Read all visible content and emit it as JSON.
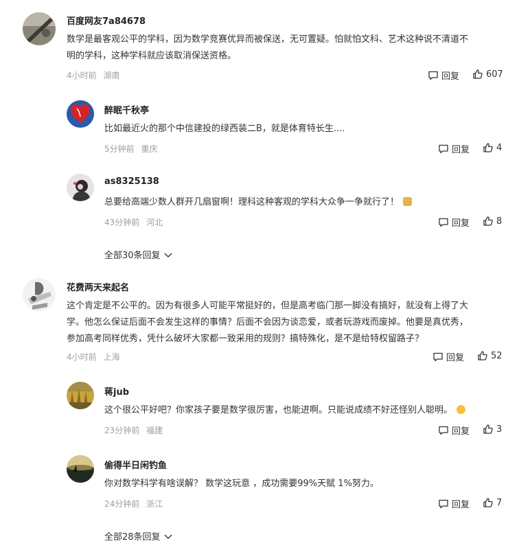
{
  "comments": [
    {
      "name": "百度网友7a84678",
      "lines": [
        "数学是最客观公平的学科，因为数学竞赛优异而被保送，无可置疑。怕就怕文科、艺术这种说不清道不",
        "明的学科，这种学科就应该取消保送资格。"
      ],
      "time": "4小时前",
      "region": "湖南",
      "reply": "回复",
      "likes": "607",
      "replies": [
        {
          "name": "醉眠千秋亭",
          "text": "比如最近火的那个中信建投的绿西装二B，就是体育特长生....",
          "time": "5分钟前",
          "region": "重庆",
          "reply": "回复",
          "likes": "4"
        },
        {
          "name": "as8325138",
          "text": "总要给高端少数人群开几扇窗啊！理科这种客观的学科大众争一争就行了！",
          "time": "43分钟前",
          "region": "河北",
          "reply": "回复",
          "likes": "8"
        }
      ],
      "more": "全部30条回复"
    },
    {
      "name": "花费两天来起名",
      "lines": [
        "这个肯定是不公平的。因为有很多人可能平常挺好的，但是高考临门那一脚没有搞好，就没有上得了大",
        "学。他怎么保证后面不会发生这样的事情？后面不会因为谈恋爱，或者玩游戏而废掉。他要是真优秀，",
        "参加高考同样优秀，凭什么破坏大家都一致采用的规则？搞特殊化，是不是给特权留路子？"
      ],
      "time": "4小时前",
      "region": "上海",
      "reply": "回复",
      "likes": "52",
      "replies": [
        {
          "name": "蒋jub",
          "text": "这个很公平好吧？你家孩子要是数学很厉害，也能进啊。只能说成绩不好还怪别人聪明。",
          "time": "23分钟前",
          "region": "福建",
          "reply": "回复",
          "likes": "3"
        },
        {
          "name": "偷得半日闲钓鱼",
          "text": "你对数学科学有啥误解？ 数学这玩意 ，成功需要99%天赋 1%努力。",
          "time": "24分钟前",
          "region": "浙江",
          "reply": "回复",
          "likes": "7"
        }
      ],
      "more": "全部28条回复"
    }
  ]
}
